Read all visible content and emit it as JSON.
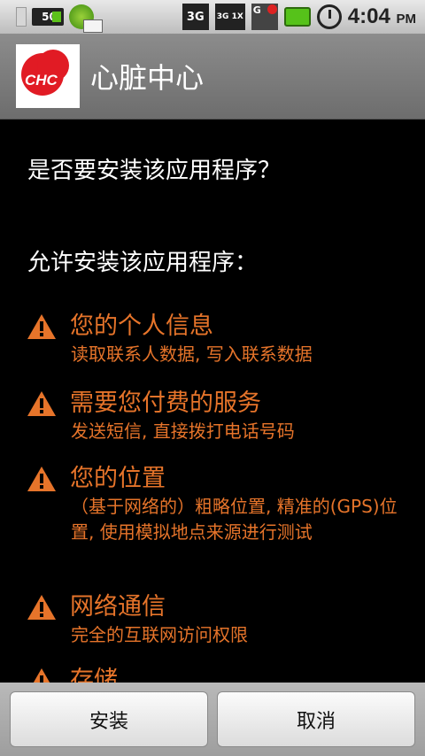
{
  "status_bar": {
    "battery_small_label": "50",
    "network_3g_label": "3G",
    "network_3g1x_label": "3G 1X",
    "signal_label": "G",
    "time": "4:04",
    "ampm": "PM",
    "icons": [
      "sd-card-icon",
      "battery-saver-icon",
      "coin-icon",
      "mail-icon",
      "3g-data-icon",
      "3g-1x-icon",
      "signal-icon",
      "battery-icon",
      "alarm-icon"
    ]
  },
  "title_bar": {
    "logo_text": "CHC",
    "app_title": "心脏中心"
  },
  "content": {
    "question": "是否要安装该应用程序？",
    "allow_header": "允许安装该应用程序：",
    "permissions": [
      {
        "title": "您的个人信息",
        "description": "读取联系人数据, 写入联系数据"
      },
      {
        "title": "需要您付费的服务",
        "description": "发送短信, 直接拨打电话号码"
      },
      {
        "title": "您的位置",
        "description": "（基于网络的）粗略位置, 精准的(GPS)位置, 使用模拟地点来源进行测试"
      },
      {
        "title": "网络通信",
        "description": "完全的互联网访问权限"
      },
      {
        "title": "存储",
        "description": ""
      }
    ],
    "warning_color": "#e6742a"
  },
  "buttons": {
    "install": "安装",
    "cancel": "取消"
  }
}
